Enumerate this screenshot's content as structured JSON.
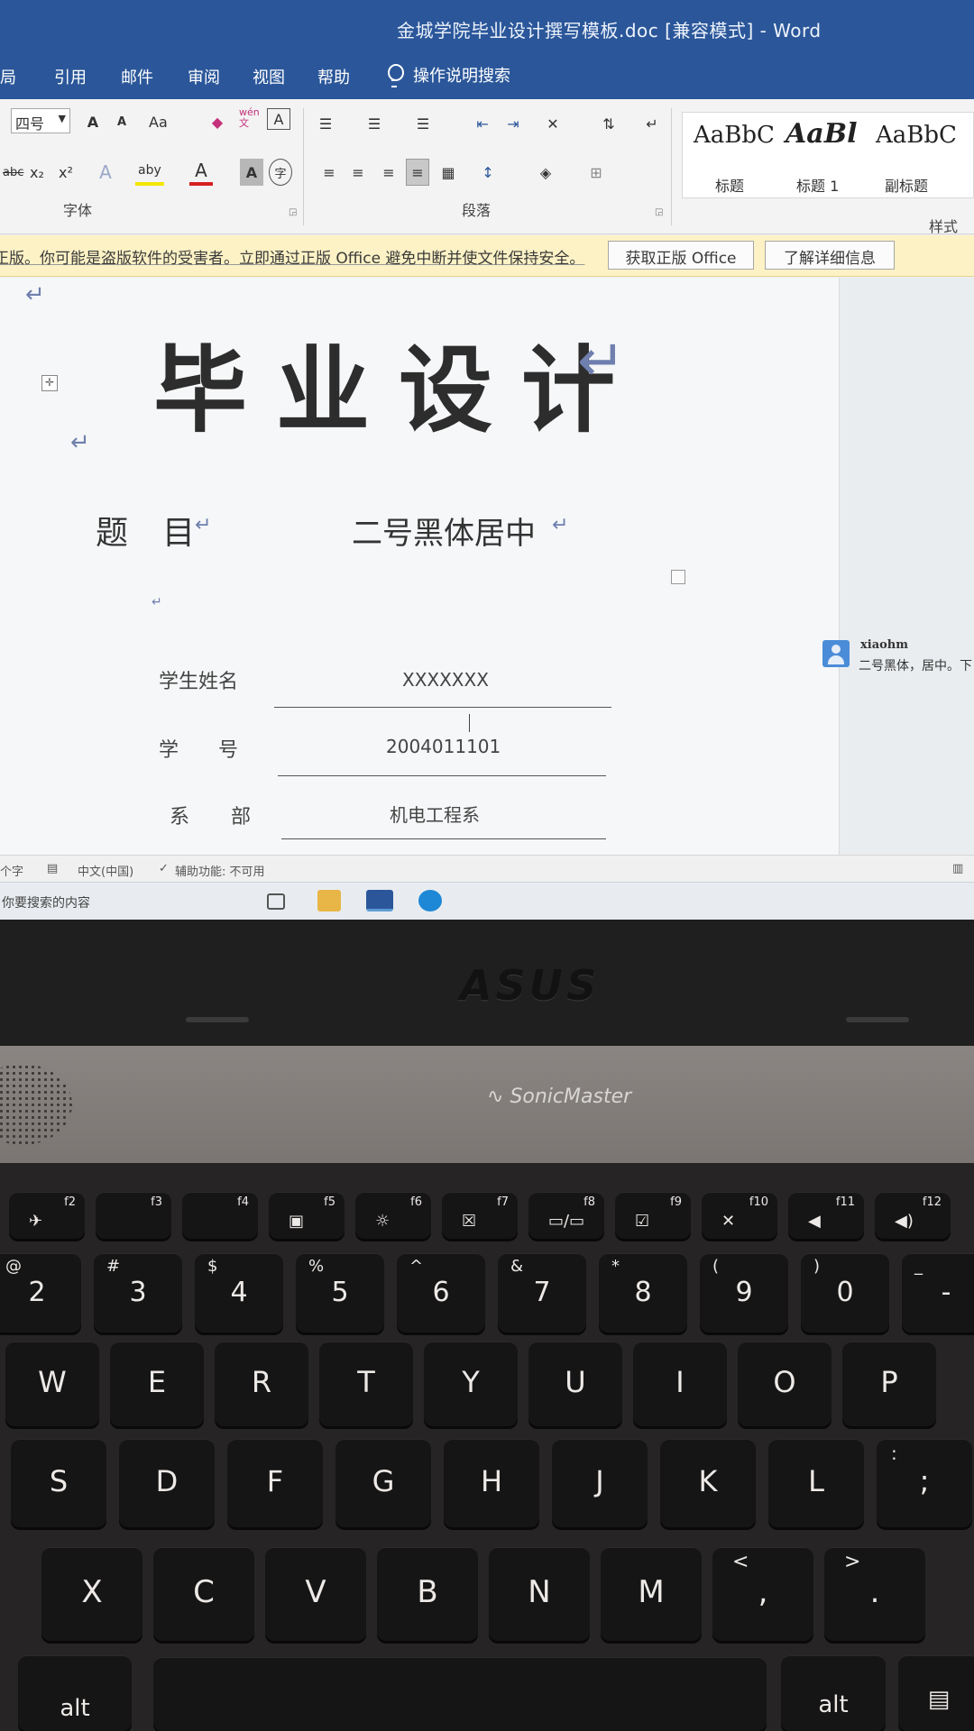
{
  "window": {
    "title": "金城学院毕业设计撰写模板.doc [兼容模式] - Word"
  },
  "menu": {
    "items": [
      "局",
      "引用",
      "邮件",
      "审阅",
      "视图",
      "帮助"
    ],
    "tell_me": "操作说明搜索"
  },
  "ribbon": {
    "font_size": "四号",
    "font_group_label": "字体",
    "paragraph_group_label": "段落",
    "styles_group_label": "样式",
    "buttons": {
      "grow_font": "A",
      "shrink_font": "A",
      "change_case": "Aa",
      "phonetic": "wén\n文",
      "char_border": "A",
      "strikethrough": "abc",
      "subscript": "x₂",
      "superscript": "x²",
      "text_effects": "A",
      "highlight": "aby",
      "font_color": "A",
      "char_shading": "A",
      "enclose_char": "字"
    },
    "styles": [
      {
        "sample": "AaBbC",
        "name": "标题"
      },
      {
        "sample": "AaBl",
        "name": "标题 1"
      },
      {
        "sample": "AaBbC",
        "name": "副标题"
      }
    ]
  },
  "warning_bar": {
    "message": "非正版。你可能是盗版软件的受害者。立即通过正版 Office 避免中断并使文件保持安全。",
    "get_genuine_button": "获取正版 Office",
    "learn_more_button": "了解详细信息"
  },
  "document": {
    "heading": "毕业设计",
    "topic_label": "题目",
    "topic_value": "二号黑体居中",
    "fields": [
      {
        "label": "学生姓名",
        "value": "XXXXXXX"
      },
      {
        "label": "学号",
        "value": "2004011101"
      },
      {
        "label": "系部",
        "value": "机电工程系"
      }
    ],
    "comment": {
      "author": "xiaohm",
      "text": "二号黑体，居中。下"
    }
  },
  "status_bar": {
    "word_count": "个字",
    "language": "中文(中国)",
    "accessibility": "辅助功能: 不可用"
  },
  "taskbar": {
    "search_placeholder": "你要搜索的内容"
  },
  "hardware": {
    "bezel_logo": "ASUS",
    "deck_label": "SonicMaster"
  },
  "keyboard": {
    "function_row": [
      "f2",
      "f3",
      "f4",
      "f5",
      "f6",
      "f7",
      "f8",
      "f9",
      "f10",
      "f11",
      "f12"
    ],
    "number_row": [
      {
        "main": "2",
        "shift": "@"
      },
      {
        "main": "3",
        "shift": "#"
      },
      {
        "main": "4",
        "shift": "$"
      },
      {
        "main": "5",
        "shift": "%"
      },
      {
        "main": "6",
        "shift": "^"
      },
      {
        "main": "7",
        "shift": "&"
      },
      {
        "main": "8",
        "shift": "*"
      },
      {
        "main": "9",
        "shift": "("
      },
      {
        "main": "0",
        "shift": ")"
      },
      {
        "main": "-",
        "shift": "_"
      }
    ],
    "top_row": [
      "W",
      "E",
      "R",
      "T",
      "Y",
      "U",
      "I",
      "O",
      "P"
    ],
    "home_row": [
      "S",
      "D",
      "F",
      "G",
      "H",
      "J",
      "K",
      "L",
      ";"
    ],
    "bottom_row": [
      "X",
      "C",
      "V",
      "B",
      "N",
      "M",
      ",",
      "."
    ],
    "bottom_row_shift": {
      "comma": "<",
      "period": ">",
      "semicolon": ":"
    },
    "alt_left": "alt",
    "alt_right": "alt"
  }
}
